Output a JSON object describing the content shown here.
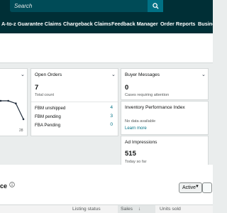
{
  "search": {
    "placeholder": "Search"
  },
  "nav": [
    {
      "label": "A-to-z Guarantee Claims"
    },
    {
      "label": "Chargeback Claims"
    },
    {
      "label": "Feedback Manager"
    },
    {
      "label": "Order Reports"
    },
    {
      "label": "Busine"
    }
  ],
  "sales_card": {
    "chart_data": {
      "type": "line",
      "values": [
        10,
        10,
        9,
        3
      ],
      "end_label": "28"
    }
  },
  "open_orders": {
    "title": "Open Orders",
    "count": "7",
    "count_label": "Total count",
    "rows": [
      {
        "label": "FBM unshipped",
        "value": "4"
      },
      {
        "label": "FBM pending",
        "value": "3"
      },
      {
        "label": "FBA Pending",
        "value": "0"
      }
    ]
  },
  "buyer_messages": {
    "title": "Buyer Messages",
    "count": "0",
    "count_label": "Cases requiring attention"
  },
  "inventory": {
    "title": "Inventory Performance Index",
    "status": "No data available",
    "link": "Learn more"
  },
  "ad_impressions": {
    "title": "Ad Impressions",
    "value": "515",
    "value_label": "Today so far"
  },
  "listings": {
    "title_fragment": "ce",
    "filter_value": "Active",
    "columns": [
      {
        "label": "Listing status"
      },
      {
        "label": "Sales"
      },
      {
        "label": "Units sold"
      }
    ]
  },
  "colors": {
    "nav_bg": "#002f36",
    "search_btn": "#007185",
    "link": "#007185"
  }
}
